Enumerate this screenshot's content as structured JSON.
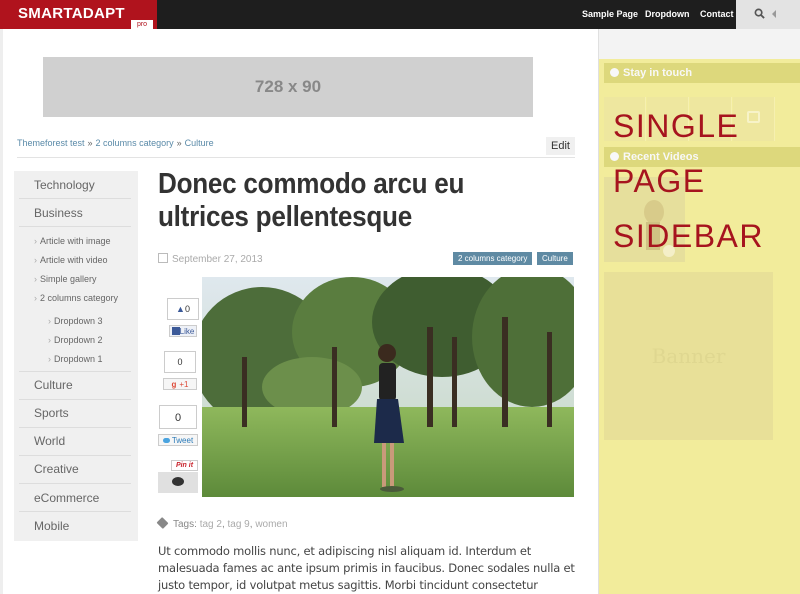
{
  "header": {
    "logo": "SMARTADAPT",
    "logo_badge": "pro",
    "nav": [
      "Sample Page",
      "Dropdown",
      "Contact"
    ]
  },
  "ad": {
    "label": "728 x 90"
  },
  "breadcrumb": [
    "Themeforest test",
    "2 columns category",
    "Culture"
  ],
  "breadcrumb_separator": "»",
  "edit_label": "Edit",
  "menu": {
    "items": [
      "Technology",
      "Business",
      "Culture",
      "Sports",
      "World",
      "Creative",
      "eCommerce",
      "Mobile"
    ],
    "business_sub": [
      "Article with image",
      "Article with video",
      "Simple gallery",
      "2 columns category"
    ],
    "dropdowns": [
      "Dropdown 3",
      "Dropdown 2",
      "Dropdown 1"
    ]
  },
  "article": {
    "title": "Donec commodo arcu eu ultrices pellentesque",
    "date": "September 27, 2013",
    "categories": [
      "2 columns category",
      "Culture"
    ],
    "tags_label": "Tags:",
    "tags": [
      "tag 2",
      "tag 9",
      "women"
    ],
    "body": "Ut commodo mollis nunc, et adipiscing nisl aliquam id. Interdum et malesuada fames ac ante ipsum primis in faucibus. Donec sodales nulla et justo tempor, id volutpat metus sagittis. Morbi tincidunt consectetur"
  },
  "social": {
    "fb_count": "0",
    "fb_label": "Like",
    "gplus_count": "0",
    "gplus_label": "+1",
    "tw_count": "0",
    "tw_label": "Tweet",
    "pin_label": "Pin it"
  },
  "sidebar": {
    "stay_in_touch": "Stay in touch",
    "recent_videos": "Recent Videos",
    "banner": "Banner",
    "overlay": [
      "SINGLE",
      "PAGE",
      "SIDEBAR"
    ]
  },
  "colors": {
    "brand": "#b0131d",
    "category_badge": "#5f8aa3",
    "sidebar_highlight": "#f2ec9b"
  }
}
